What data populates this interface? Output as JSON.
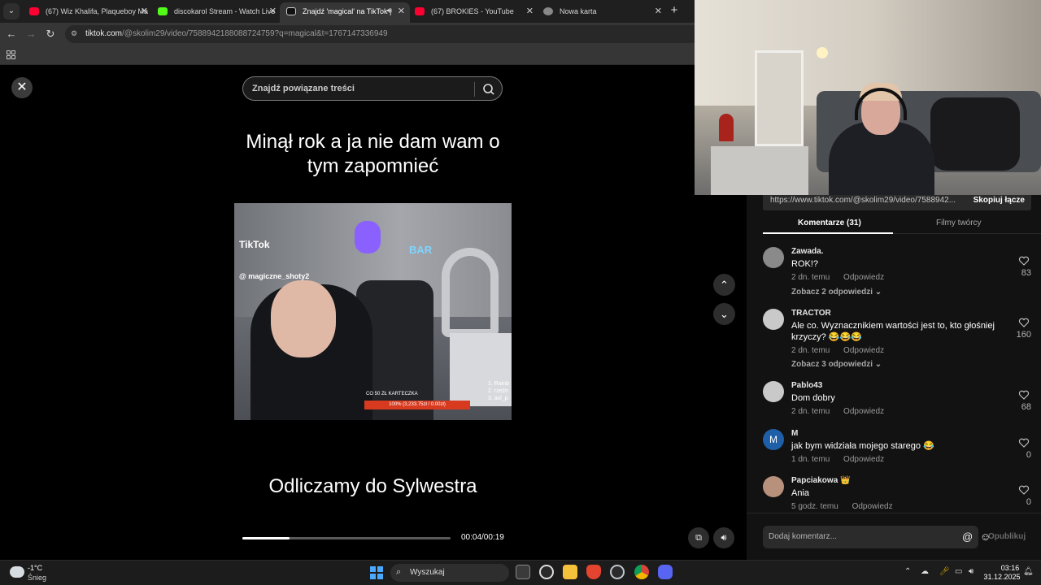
{
  "browser": {
    "tabs": [
      {
        "label": "(67) Wiz Khalifa, Plaqueboy Ma",
        "favicon_color": "#ff0033",
        "active": false
      },
      {
        "label": "discokarol Stream - Watch Live",
        "favicon_color": "#53fc18",
        "active": false
      },
      {
        "label": "Znajdź 'magical' na TikTok |",
        "favicon_color": "#111111",
        "active": true
      },
      {
        "label": "(67) BROKIES - YouTube",
        "favicon_color": "#ff0033",
        "active": false
      },
      {
        "label": "Nowa karta",
        "favicon_color": "#888888",
        "active": false
      }
    ],
    "url_host": "tiktok.com",
    "url_path": "/@skolim29/video/7588942188088724759?q=magical&t=1767147336949"
  },
  "tiktok": {
    "search_placeholder": "Znajdź powiązane treści",
    "caption_top": "Minął rok a ja nie dam wam o tym zapomnieć",
    "caption_bottom": "Odliczamy do Sylwestra",
    "clip_watermark": "TikTok",
    "clip_username": "@ magiczne_shoty2",
    "clip_donation": "CO 50 ZŁ KARTECZKA",
    "clip_bar_text": "100% (3,233.75zł / 0.00zł)",
    "clip_side_text": "1. Rainb\n2. rzeźn\n3. axl_p",
    "clip_neon": "BAR",
    "time": "00:04/00:19",
    "progress": 0.226
  },
  "comments_panel": {
    "share_url": "https://www.tiktok.com/@skolim29/video/7588942...",
    "copy_link_label": "Skopiuj łącze",
    "tab_comments": "Komentarze (31)",
    "tab_creator_videos": "Filmy twórcy",
    "reply_label": "Odpowiedz",
    "comments": [
      {
        "name": "Zawada.",
        "text": "ROK!?",
        "time": "2 dn. temu",
        "likes": "83",
        "replies": "Zobacz 2 odpowiedzi"
      },
      {
        "name": "TRACTOR",
        "text": "Ale co. Wyznacznikiem wartości jest to, kto głośniej krzyczy? 😂😂😂",
        "time": "2 dn. temu",
        "likes": "160",
        "replies": "Zobacz 3 odpowiedzi"
      },
      {
        "name": "Pablo43",
        "text": "Dom dobry",
        "time": "2 dn. temu",
        "likes": "68",
        "replies": ""
      },
      {
        "name": "M",
        "text": "jak bym widziała mojego starego 😂",
        "time": "1 dn. temu",
        "likes": "0",
        "replies": ""
      },
      {
        "name": "Papciakowa 👑",
        "text": "Ania",
        "time": "5 godz. temu",
        "likes": "0",
        "replies": ""
      }
    ],
    "avatar_M_letter": "M",
    "composer_placeholder": "Dodaj komentarz...",
    "publish_label": "Opublikuj"
  },
  "taskbar": {
    "temperature": "-1°C",
    "weather": "Śnieg",
    "search_placeholder": "Wyszukaj",
    "time": "03:16",
    "date": "31.12.2025"
  },
  "colors": {
    "tiktok_bg": "#000000",
    "panel_bg": "#121212",
    "accent_white": "#ffffff",
    "progress_track": "#5a5a5a"
  }
}
